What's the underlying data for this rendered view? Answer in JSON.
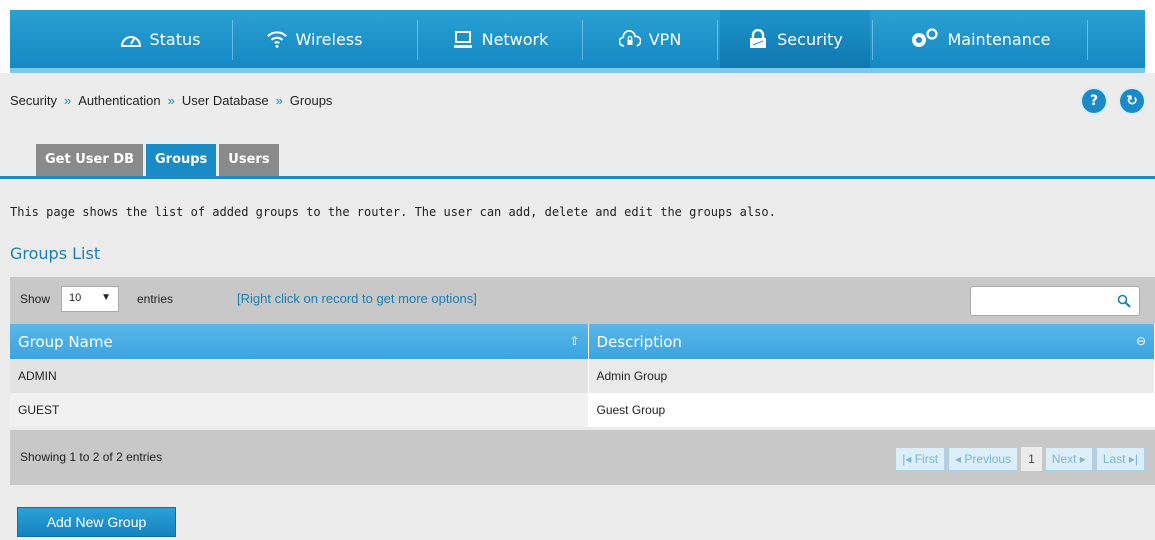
{
  "nav": {
    "items": [
      {
        "label": "Status",
        "icon": "gauge-icon"
      },
      {
        "label": "Wireless",
        "icon": "wifi-icon"
      },
      {
        "label": "Network",
        "icon": "monitor-icon"
      },
      {
        "label": "VPN",
        "icon": "cloud-lock-icon"
      },
      {
        "label": "Security",
        "icon": "padlock-icon"
      },
      {
        "label": "Maintenance",
        "icon": "gears-icon"
      }
    ],
    "active": "Security"
  },
  "breadcrumb": [
    "Security",
    "Authentication",
    "User Database",
    "Groups"
  ],
  "breadcrumb_sep": "»",
  "help_buttons": {
    "help": "?",
    "refresh": "↻"
  },
  "tabs": [
    {
      "label": "Get User DB",
      "active": false
    },
    {
      "label": "Groups",
      "active": true
    },
    {
      "label": "Users",
      "active": false
    }
  ],
  "description": "This page shows the list of added groups to the router. The user can add, delete and edit the groups also.",
  "section_title": "Groups List",
  "toolbar": {
    "show_label": "Show",
    "page_size": "10",
    "entries_label": "entries",
    "hint": "[Right click on record to get more options]",
    "search_value": ""
  },
  "table": {
    "columns": [
      "Group Name",
      "Description"
    ],
    "rows": [
      [
        "ADMIN",
        "Admin Group"
      ],
      [
        "GUEST",
        "Guest Group"
      ]
    ]
  },
  "footer": {
    "info": "Showing 1 to 2 of 2 entries",
    "pager": [
      "First",
      "Previous",
      "1",
      "Next",
      "Last"
    ]
  },
  "add_button": "Add New Group",
  "colors": {
    "accent": "#1a8bc6",
    "nav": "#1b90c9",
    "toolbar": "#c8c8c8"
  }
}
